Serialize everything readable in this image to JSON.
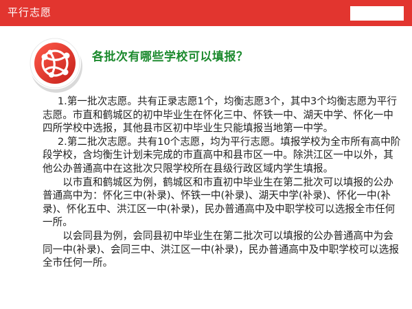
{
  "header": {
    "title": "平行志愿"
  },
  "heading": "各批次有哪些学校可以填报？",
  "logo_icon": "globe-network-icon",
  "colors": {
    "header_red": "#e2352f",
    "heading_green": "#1c8a2e"
  },
  "paragraphs": [
    "1.第一批次志愿。共有正录志愿1个，均衡志愿3个，其中3个均衡志愿为平行志愿。市直和鹤城区的初中毕业生在怀化三中、怀铁一中、湖天中学、怀化一中四所学校中选报，其他县市区初中毕业生只能填报当地第一中学。",
    "2.第二批次志愿。共有10个志愿，均为平行志愿。填报学校为全市所有高中阶段学校，含均衡生计划未完成的市直高中和县市区一中。除洪江区一中以外，其他公办普通高中在这批次只限学校所在县级行政区域内学生填报。",
    "以市直和鹤城区为例，鹤城区和市直初中毕业生在第二批次可以填报的公办普通高中为：怀化三中(补录)、怀铁一中(补录)、湖天中学(补录)、怀化一中(补录)、怀化五中、洪江区一中(补录)，民办普通高中及中职学校可以选报全市任何一所。",
    "以会同县为例，会同县初中毕业生在第二批次可以填报的公办普通高中为会同一中(补录)、会同三中、洪江区一中(补录)，民办普通高中及中职学校可以选报全市任何一所。"
  ]
}
